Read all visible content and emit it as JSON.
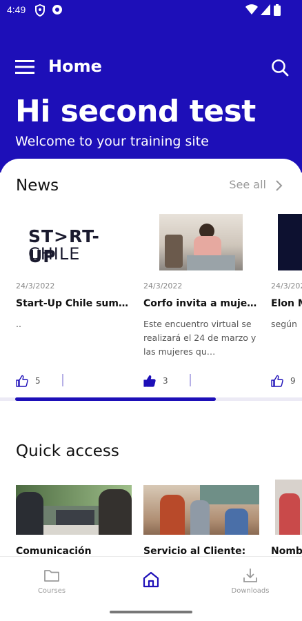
{
  "status_bar": {
    "time": "4:49"
  },
  "header": {
    "title": "Home",
    "greeting": "Hi second test",
    "subtitle": "Welcome to your training site"
  },
  "colors": {
    "brand": "#1d0fb8",
    "accent_light": "#b6b0e6",
    "text_muted": "#888888"
  },
  "news": {
    "title": "News",
    "see_all": "See all",
    "items": [
      {
        "image_label": "ST>RT-UP",
        "image_label_2": "CHILE",
        "date": "24/3/2022",
        "title": "Start-Up Chile sum…",
        "body": "..",
        "likes": "5",
        "liked": false
      },
      {
        "date": "24/3/2022",
        "title": "Corfo invita a muje…",
        "body": "Este encuentro virtual se realizará el 24 de marzo y las mujeres qu…",
        "likes": "3",
        "liked": true
      },
      {
        "date": "24/3/2022",
        "title": "Elon M",
        "body": "según",
        "likes": "9",
        "liked": false
      }
    ]
  },
  "quick_access": {
    "title": "Quick access",
    "items": [
      {
        "title": "Comunicación"
      },
      {
        "title": "Servicio al Cliente:"
      },
      {
        "title": "Nomb"
      }
    ]
  },
  "bottom_nav": {
    "items": [
      {
        "label": "Courses",
        "icon": "folder-icon"
      },
      {
        "label": "",
        "icon": "home-icon",
        "active": true
      },
      {
        "label": "Downloads",
        "icon": "download-icon"
      }
    ]
  }
}
